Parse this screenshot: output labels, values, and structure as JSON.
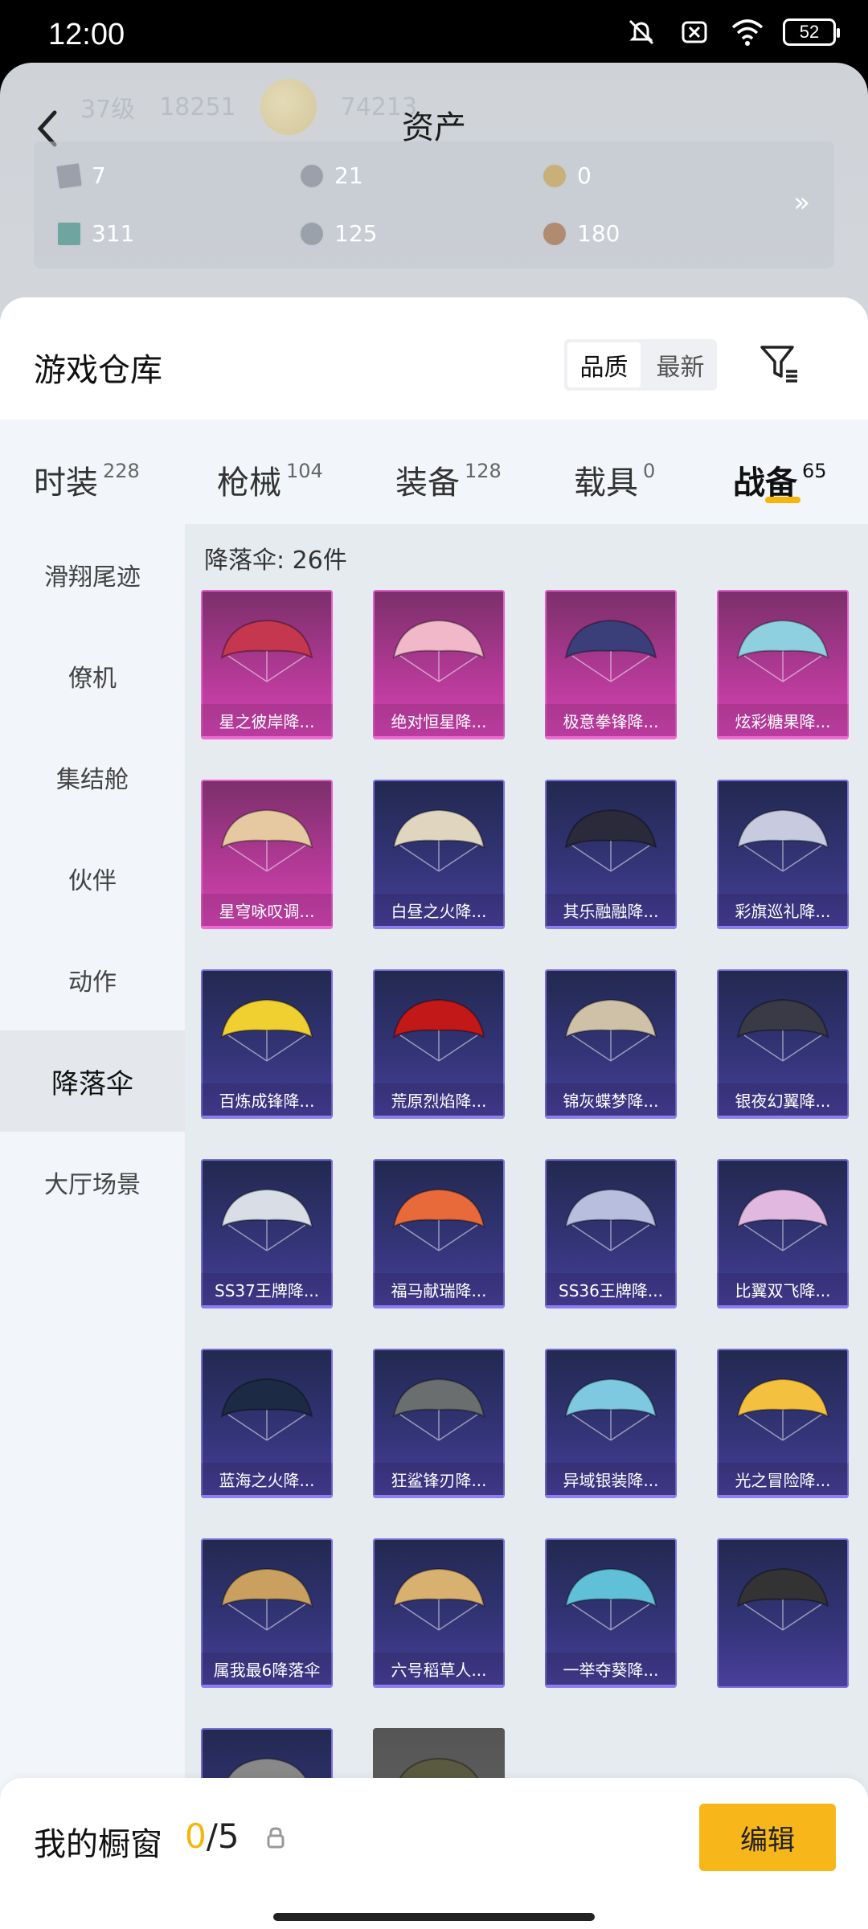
{
  "status_bar": {
    "time": "12:00",
    "battery": "52"
  },
  "header": {
    "title": "资产",
    "faded_level": "37级",
    "faded_points": "18251",
    "faded_coins": "74213",
    "currencies": [
      {
        "icon": "card-icon",
        "value": "7"
      },
      {
        "icon": "silver-coin-icon",
        "value": "21"
      },
      {
        "icon": "gold-coin-icon",
        "value": "0"
      },
      {
        "icon": "teal-card-icon",
        "value": "311"
      },
      {
        "icon": "gray-coin-icon",
        "value": "125"
      },
      {
        "icon": "bronze-coin-icon",
        "value": "180"
      }
    ]
  },
  "warehouse": {
    "title": "游戏仓库",
    "sort_options": [
      "品质",
      "最新"
    ],
    "active_sort": "品质"
  },
  "tabs": [
    {
      "label": "时装",
      "count": "228"
    },
    {
      "label": "枪械",
      "count": "104"
    },
    {
      "label": "装备",
      "count": "128"
    },
    {
      "label": "载具",
      "count": "0"
    },
    {
      "label": "战备",
      "count": "65"
    }
  ],
  "sidebar": [
    "滑翔尾迹",
    "僚机",
    "集结舱",
    "伙伴",
    "动作",
    "降落伞",
    "大厅场景"
  ],
  "category_header": "降落伞: 26件",
  "items": [
    {
      "name": "星之彼岸降...",
      "rarity": "purple",
      "color": "#c4374f"
    },
    {
      "name": "绝对恒星降...",
      "rarity": "purple",
      "color": "#f0b8c8"
    },
    {
      "name": "极意拳锋降...",
      "rarity": "purple",
      "color": "#3a3f7a"
    },
    {
      "name": "炫彩糖果降...",
      "rarity": "purple",
      "color": "#8fd0e0"
    },
    {
      "name": "星穹咏叹调...",
      "rarity": "purple",
      "color": "#e6c9a0"
    },
    {
      "name": "白昼之火降...",
      "rarity": "blue",
      "color": "#e0d6c0"
    },
    {
      "name": "其乐融融降...",
      "rarity": "blue",
      "color": "#2a2a3a"
    },
    {
      "name": "彩旗巡礼降...",
      "rarity": "blue",
      "color": "#c8cbe0"
    },
    {
      "name": "百炼成锋降...",
      "rarity": "blue",
      "color": "#f0d030"
    },
    {
      "name": "荒原烈焰降...",
      "rarity": "blue",
      "color": "#c21818"
    },
    {
      "name": "锦灰蝶梦降...",
      "rarity": "blue",
      "color": "#cfc1a8"
    },
    {
      "name": "银夜幻翼降...",
      "rarity": "blue",
      "color": "#3a3a46"
    },
    {
      "name": "SS37王牌降...",
      "rarity": "blue",
      "color": "#d8dde6"
    },
    {
      "name": "福马献瑞降...",
      "rarity": "blue",
      "color": "#e86a3a"
    },
    {
      "name": "SS36王牌降...",
      "rarity": "blue",
      "color": "#b8bede"
    },
    {
      "name": "比翼双飞降...",
      "rarity": "blue",
      "color": "#e0b8e0"
    },
    {
      "name": "蓝海之火降...",
      "rarity": "blue",
      "color": "#1c2a44"
    },
    {
      "name": "狂鲨锋刃降...",
      "rarity": "blue",
      "color": "#6a6e6e"
    },
    {
      "name": "异域银装降...",
      "rarity": "blue",
      "color": "#7ec8e0"
    },
    {
      "name": "光之冒险降...",
      "rarity": "blue",
      "color": "#f4c040"
    },
    {
      "name": "属我最6降落伞",
      "rarity": "blue",
      "color": "#c9a060"
    },
    {
      "name": "六号稻草人...",
      "rarity": "blue",
      "color": "#d8b070"
    },
    {
      "name": "一举夺葵降...",
      "rarity": "blue",
      "color": "#60c0d8"
    },
    {
      "name": "",
      "rarity": "blue",
      "color": "#333"
    },
    {
      "name": "",
      "rarity": "blue",
      "color": "#888"
    },
    {
      "name": "",
      "rarity": "gray",
      "color": "#5a5a40"
    }
  ],
  "showcase": {
    "label": "我的橱窗",
    "current": "0",
    "total": "/5",
    "edit_label": "编辑"
  }
}
